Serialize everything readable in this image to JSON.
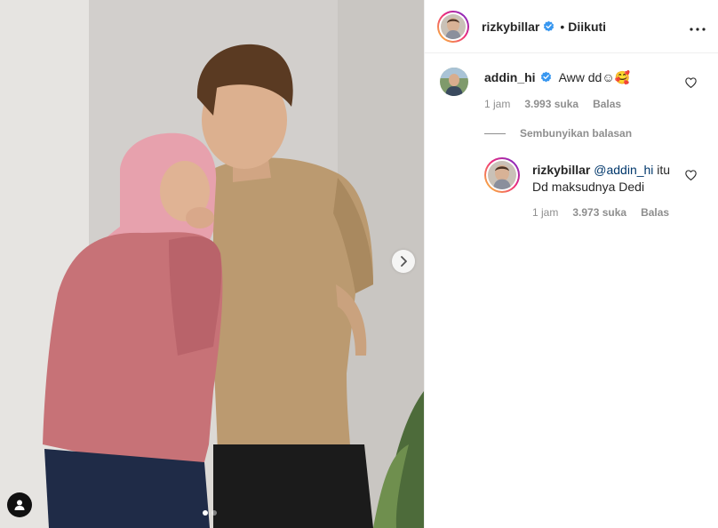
{
  "post": {
    "author": "rizkybillar",
    "follow_status": "Diikuti",
    "bullet": "•",
    "more_icon": "more-horizontal-icon"
  },
  "comments": [
    {
      "username": "addin_hi",
      "text": "Aww dd☺🥰",
      "time": "1 jam",
      "likes": "3.993 suka",
      "reply_label": "Balas"
    }
  ],
  "hide_replies_label": "Sembunyikan balasan",
  "replies": [
    {
      "username": "rizkybillar",
      "mention": "@addin_hi",
      "text_after_mention": " itu",
      "text_line2": "Dd maksudnya Dedi",
      "time": "1 jam",
      "likes": "3.973 suka",
      "reply_label": "Balas"
    }
  ],
  "colors": {
    "verified_blue": "#3897f0",
    "mention": "#00376b",
    "muted": "#8e8e8e"
  },
  "carousel": {
    "slide_count": 2,
    "active_slide": 1
  }
}
